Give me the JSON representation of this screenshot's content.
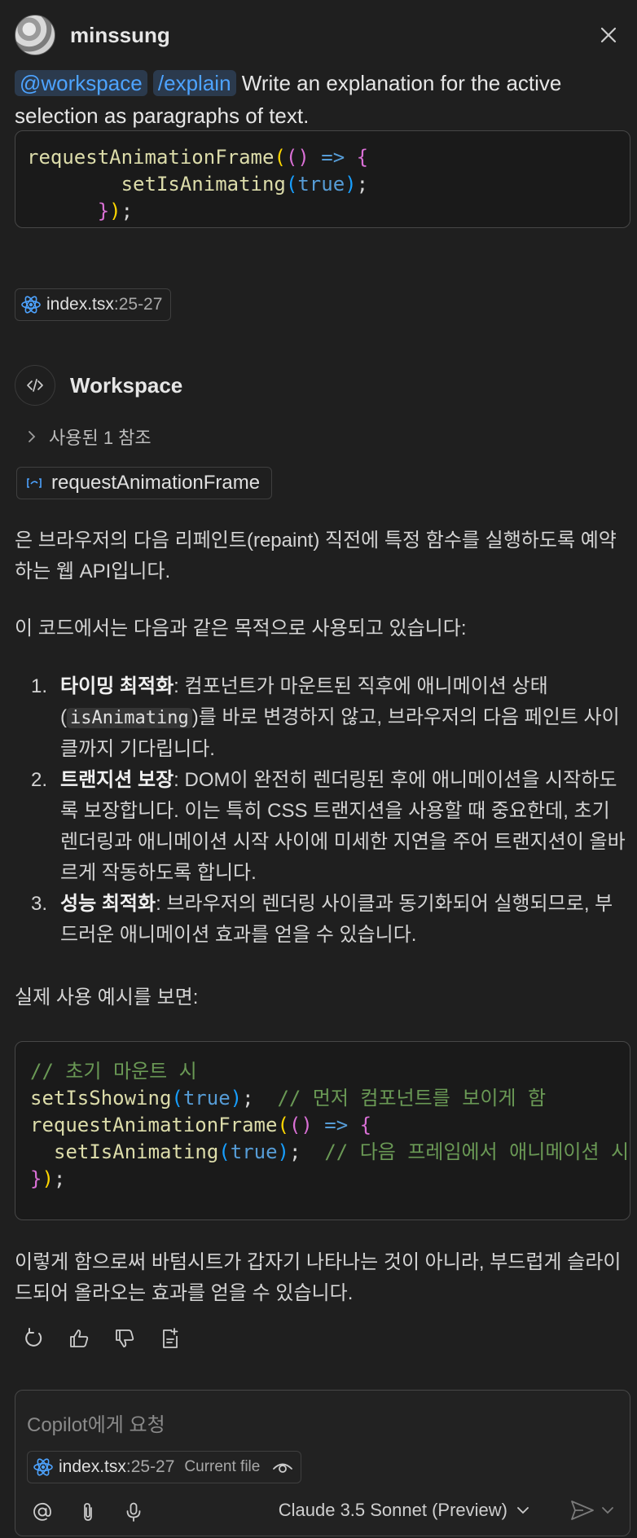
{
  "header": {
    "username": "minssung",
    "close_icon": "close-icon"
  },
  "prompt": {
    "workspace_chip": "@workspace",
    "command_chip": "/explain",
    "text": "Write an explanation for the active selection as paragraphs of text."
  },
  "selection_code": {
    "lines": [
      [
        "requestAnimationFrame",
        "(",
        "()",
        " => ",
        "{"
      ],
      [
        "        setIsAnimating",
        "(",
        "true",
        ")",
        ";"
      ],
      [
        "      ",
        "}",
        ")",
        ";"
      ]
    ]
  },
  "file_reference": {
    "name": "index.tsx",
    "lines": ":25-27"
  },
  "response": {
    "agent_title": "Workspace",
    "references_label": "사용된 1 참조",
    "symbol_chip": "requestAnimationFrame",
    "intro": "은 브라우저의 다음 리페인트(repaint) 직전에 특정 함수를 실행하도록 예약하는 웹 API입니다.",
    "purpose_heading": "이 코드에서는 다음과 같은 목적으로 사용되고 있습니다:",
    "items": [
      {
        "num": "1.",
        "title": "타이밍 최적화",
        "before": ": 컴포넌트가 마운트된 직후에 애니메이션 상태(",
        "code": "isAnimating",
        "after": ")를 바로 변경하지 않고, 브라우저의 다음 페인트 사이클까지 기다립니다."
      },
      {
        "num": "2.",
        "title": "트랜지션 보장",
        "before": ": DOM이 완전히 렌더링된 후에 애니메이션을 시작하도록 보장합니다. 이는 특히 CSS 트랜지션을 사용할 때 중요한데, 초기 렌더링과 애니메이션 시작 사이에 미세한 지연을 주어 트랜지션이 올바르게 작동하도록 합니다.",
        "code": "",
        "after": ""
      },
      {
        "num": "3.",
        "title": "성능 최적화",
        "before": ": 브라우저의 렌더링 사이클과 동기화되어 실행되므로, 부드러운 애니메이션 효과를 얻을 수 있습니다.",
        "code": "",
        "after": ""
      }
    ],
    "example_heading": "실제 사용 예시를 보면:",
    "example_code": {
      "comment1": "// 초기 마운트 시",
      "line2_fn": "setIsShowing",
      "line2_val": "true",
      "line2_comment": "// 먼저 컴포넌트를 보이게 함",
      "line3_fn": "requestAnimationFrame",
      "line4_fn": "setIsAnimating",
      "line4_val": "true",
      "line4_comment": "// 다음 프레임에서 애니메이션 시작"
    },
    "conclusion": "이렇게 함으로써 바텀시트가 갑자기 나타나는 것이 아니라, 부드럽게 슬라이드되어 올라오는 효과를 얻을 수 있습니다."
  },
  "input": {
    "placeholder": "Copilot에게 요청",
    "context_file": "index.tsx",
    "context_lines": ":25-27",
    "context_label": "Current file",
    "model": "Claude 3.5 Sonnet (Preview)"
  }
}
